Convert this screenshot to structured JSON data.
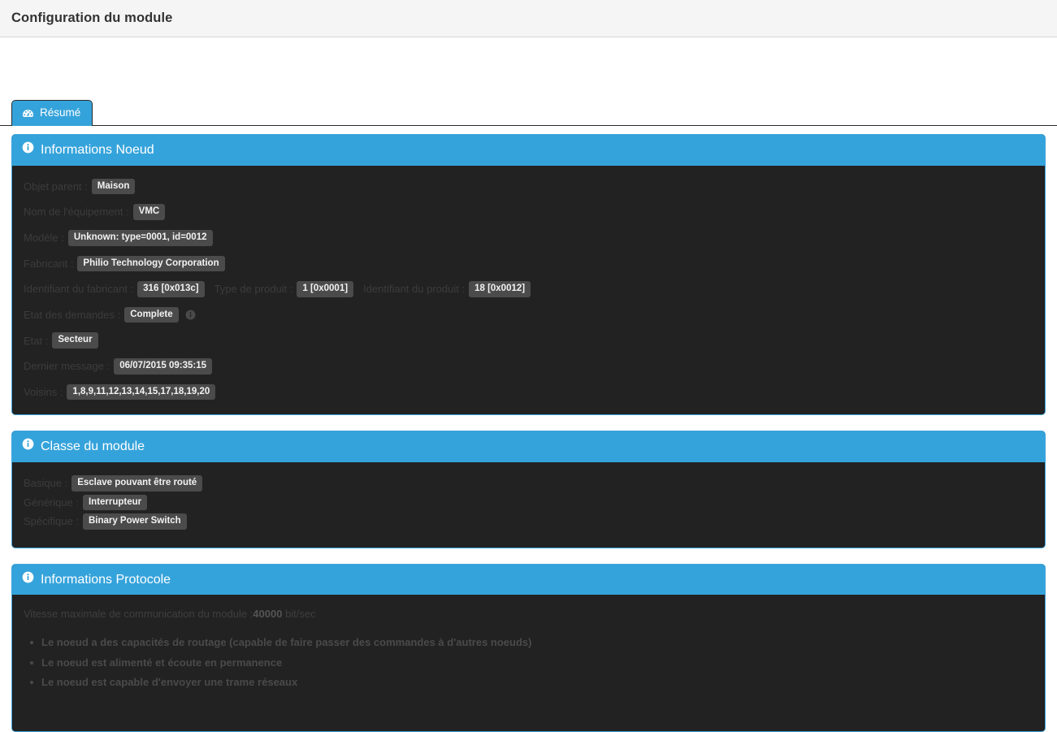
{
  "header": {
    "title": "Configuration du module"
  },
  "tabs": [
    {
      "label": "Résumé",
      "icon": "dashboard-icon",
      "active": true
    }
  ],
  "panels": {
    "node_info": {
      "icon": "info-circle-icon",
      "title": "Informations Noeud",
      "rows": [
        {
          "label": "Objet parent :",
          "value": "Maison"
        },
        {
          "label": "Nom de l'équipement :",
          "value": "VMC"
        },
        {
          "label": "Modèle :",
          "value": "Unknown: type=0001, id=0012"
        },
        {
          "label": "Fabricant :",
          "value": "Philio Technology Corporation"
        }
      ],
      "ids_row": [
        {
          "label": "Identifiant du fabricant :",
          "value": "316 [0x013c]"
        },
        {
          "label": "Type de produit :",
          "value": "1 [0x0001]"
        },
        {
          "label": "Identifiant du produit :",
          "value": "18 [0x0012]"
        }
      ],
      "requests_label": "Etat des demandes :",
      "requests_value": "Complete",
      "requests_help_icon": "info-circle-icon",
      "state_label": "Etat :",
      "state_value": "Secteur",
      "last_message_label": "Dernier message :",
      "last_message_value": "06/07/2015 09:35:15",
      "neighbours_label": "Voisins :",
      "neighbours_value": "1,8,9,11,12,13,14,15,17,18,19,20"
    },
    "module_class": {
      "icon": "info-circle-icon",
      "title": "Classe du module",
      "rows": [
        {
          "label": "Basique :",
          "value": "Esclave pouvant être routé"
        },
        {
          "label": "Générique :",
          "value": "Interrupteur"
        },
        {
          "label": "Spécifique :",
          "value": "Binary Power Switch"
        }
      ]
    },
    "protocol_info": {
      "icon": "info-circle-icon",
      "title": "Informations Protocole",
      "speed_prefix": "Vitesse maximale de communication du module :",
      "speed_value": "40000",
      "speed_suffix": " bit/sec",
      "capabilities": [
        "Le noeud a des capacités de routage (capable de faire passer des commandes à d'autres noeuds)",
        "Le noeud est alimenté et écoute en permanence",
        "Le noeud est capable d'envoyer une trame réseaux"
      ]
    }
  },
  "colors": {
    "accent": "#35a3db",
    "panel_border": "#3ba3dc",
    "panel_body": "#222222",
    "badge": "#4b4b4b",
    "header_bar": "#f5f5f5"
  }
}
